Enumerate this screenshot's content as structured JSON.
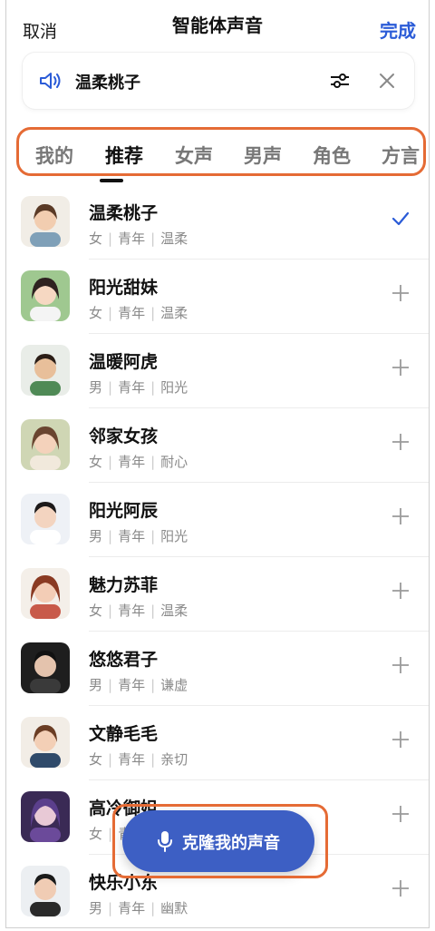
{
  "header": {
    "cancel_label": "取消",
    "title": "智能体声音",
    "done_label": "完成"
  },
  "current_voice": {
    "name": "温柔桃子",
    "icons": [
      "speaker-icon",
      "adjust-icon",
      "close-icon"
    ]
  },
  "tabs": [
    {
      "label": "我的",
      "active": false
    },
    {
      "label": "推荐",
      "active": true
    },
    {
      "label": "女声",
      "active": false
    },
    {
      "label": "男声",
      "active": false
    },
    {
      "label": "角色",
      "active": false
    },
    {
      "label": "方言",
      "active": false
    }
  ],
  "voices": [
    {
      "name": "温柔桃子",
      "gender": "女",
      "age": "青年",
      "style": "温柔",
      "selected": true
    },
    {
      "name": "阳光甜妹",
      "gender": "女",
      "age": "青年",
      "style": "温柔",
      "selected": false
    },
    {
      "name": "温暖阿虎",
      "gender": "男",
      "age": "青年",
      "style": "阳光",
      "selected": false
    },
    {
      "name": "邻家女孩",
      "gender": "女",
      "age": "青年",
      "style": "耐心",
      "selected": false
    },
    {
      "name": "阳光阿辰",
      "gender": "男",
      "age": "青年",
      "style": "阳光",
      "selected": false
    },
    {
      "name": "魅力苏菲",
      "gender": "女",
      "age": "青年",
      "style": "温柔",
      "selected": false
    },
    {
      "name": "悠悠君子",
      "gender": "男",
      "age": "青年",
      "style": "谦虚",
      "selected": false
    },
    {
      "name": "文静毛毛",
      "gender": "女",
      "age": "青年",
      "style": "亲切",
      "selected": false
    },
    {
      "name": "高冷御姐",
      "gender": "女",
      "age": "青年",
      "style": "",
      "selected": false
    },
    {
      "name": "快乐小东",
      "gender": "男",
      "age": "青年",
      "style": "幽默",
      "selected": false
    }
  ],
  "clone_button": {
    "label": "克隆我的声音",
    "icon": "mic-icon"
  },
  "colors": {
    "accent": "#2a5bd7",
    "clone_button": "#3d5fc4",
    "highlight": "#e56b35"
  }
}
